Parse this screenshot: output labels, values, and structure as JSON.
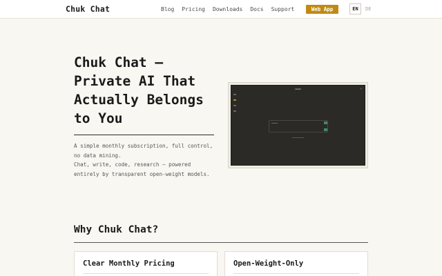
{
  "header": {
    "brand": "Chuk Chat",
    "nav": [
      "Blog",
      "Pricing",
      "Downloads",
      "Docs",
      "Support"
    ],
    "cta": "Web App",
    "languages": {
      "active": "EN",
      "other": "DE"
    },
    "accent_color": "#c08a12"
  },
  "hero": {
    "title": "Chuk Chat — Private AI That Actually Belongs to You",
    "description_lines": [
      "A simple monthly subscription, full control, no data mining.",
      "Chat, write, code, research — powered entirely by transparent open-weight models."
    ]
  },
  "why": {
    "title": "Why Chuk Chat?",
    "cards": [
      {
        "title": "Clear Monthly Pricing"
      },
      {
        "title": "Open-Weight-Only"
      }
    ]
  }
}
